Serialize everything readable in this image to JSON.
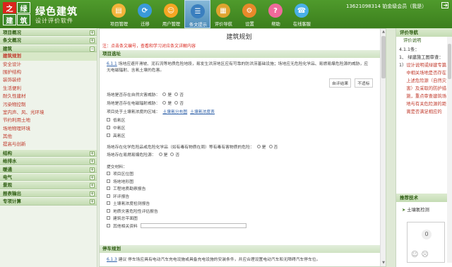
{
  "header": {
    "logo_chars": [
      "之",
      "绿",
      "建",
      "筑"
    ],
    "title": "绿色建筑",
    "subtitle": "设计评价软件",
    "account_text": "13621098314 铂金级会员（我是）"
  },
  "nav": [
    {
      "label": "项目管理",
      "icon": "folder-icon",
      "color": "#f2b43a",
      "glyph": "▤"
    },
    {
      "label": "迁移",
      "icon": "refresh-icon",
      "color": "#3a9ad9",
      "glyph": "⟳"
    },
    {
      "label": "用户管理",
      "icon": "user-icon",
      "color": "#f5a623",
      "glyph": "☺"
    },
    {
      "label": "条文提示",
      "icon": "document-icon",
      "color": "#3a7fbf",
      "glyph": "☰"
    },
    {
      "label": "评价导航",
      "icon": "nav-icon",
      "color": "#e0a42f",
      "glyph": "▦"
    },
    {
      "label": "设置",
      "icon": "gear-icon",
      "color": "#e8892a",
      "glyph": "⚙"
    },
    {
      "label": "帮助",
      "icon": "help-icon",
      "color": "#f06a9b",
      "glyph": "?"
    },
    {
      "label": "在线客服",
      "icon": "service-icon",
      "color": "#4ab0e8",
      "glyph": "☎"
    }
  ],
  "sidebar": [
    {
      "label": "项目概况",
      "group": true
    },
    {
      "label": "条文概况",
      "group": true
    },
    {
      "label": "建筑",
      "group": true,
      "expanded": true
    },
    {
      "label": "建筑规划",
      "selected": true
    },
    {
      "label": "安全设计"
    },
    {
      "label": "围护结构"
    },
    {
      "label": "装饰装修"
    },
    {
      "label": "生活便利"
    },
    {
      "label": "耐久性建材"
    },
    {
      "label": "污染物控制"
    },
    {
      "label": "室内声、风、光环境"
    },
    {
      "label": "节约利用土地"
    },
    {
      "label": "场地物理环境"
    },
    {
      "label": "其他"
    },
    {
      "label": "提高与创新"
    },
    {
      "label": "结构",
      "group": true
    },
    {
      "label": "给排水",
      "group": true
    },
    {
      "label": "暖通",
      "group": true
    },
    {
      "label": "电气",
      "group": true
    },
    {
      "label": "景观",
      "group": true
    },
    {
      "label": "报表输出",
      "group": true
    },
    {
      "label": "专项计算",
      "group": true
    }
  ],
  "main": {
    "title": "建筑规划",
    "warning": "注：点击条文编号，查看和学习对应条文详解内容",
    "section1": "项目选址",
    "clause1_num": "6.1.1",
    "clause1_text": "场地应避开滑坡、泥石流等地质危险地段，易发生洪涝地区应有可靠的防洪涝基础设施；场地应无危险化学品、易燃易爆危险源的威胁，应无电磁辐射、含氡土壤的危害。",
    "btn_finish": "自评结果",
    "btn_na": "不适标",
    "q1": "场地是否存在自然灾害威胁：",
    "q2": "场地是否存在电磁辐射威胁：",
    "q3": "项目处于土壤氡浓度的区域：",
    "q3_link1": "土壤氡分布图",
    "q3_link2": "土壤氡浓度表",
    "yes": "是",
    "no": "否",
    "zones": [
      "低氡区",
      "中氡区",
      "高氡区"
    ],
    "q4": "场地存在化学危险品或危险化学品（如有毒有物质在周）等有毒有害物质的危险：",
    "q5": "场地存在易燃易爆危险源：",
    "materials_label": "提交材料：",
    "materials": [
      "项目区位图",
      "场地地形图",
      "工程地质勘察报告",
      "环评报告",
      "土壤氡浓度检测报告",
      "地质灾害危险性评估报告",
      "建筑总平面图",
      "其他相关资料"
    ],
    "section2": "停车规划",
    "clause2_num": "6.1.3",
    "clause2_text": "建议 停车场应具有电动汽车充电设施或具备充电设施的安装条件，并应合理设置电动汽车和无障碍汽车停车位。"
  },
  "right": {
    "header": "评价导航",
    "sub": "评价说明",
    "clause_ref": "4.1.1条：",
    "item1": "1、 绿建施工图审查：",
    "item2_prefix": "1） ",
    "item2": "设计说明或绿建专篇中相关场地是否存在上述危险源（自然灾害）及采取的防护措施，重点审查建筑场地与有关危险源的距离是否满足相应的",
    "related_header": "推荐技术",
    "related_item": "土壤氡检测",
    "feedback_count": "0",
    "feedback_icons": [
      "☺",
      "☹"
    ]
  }
}
